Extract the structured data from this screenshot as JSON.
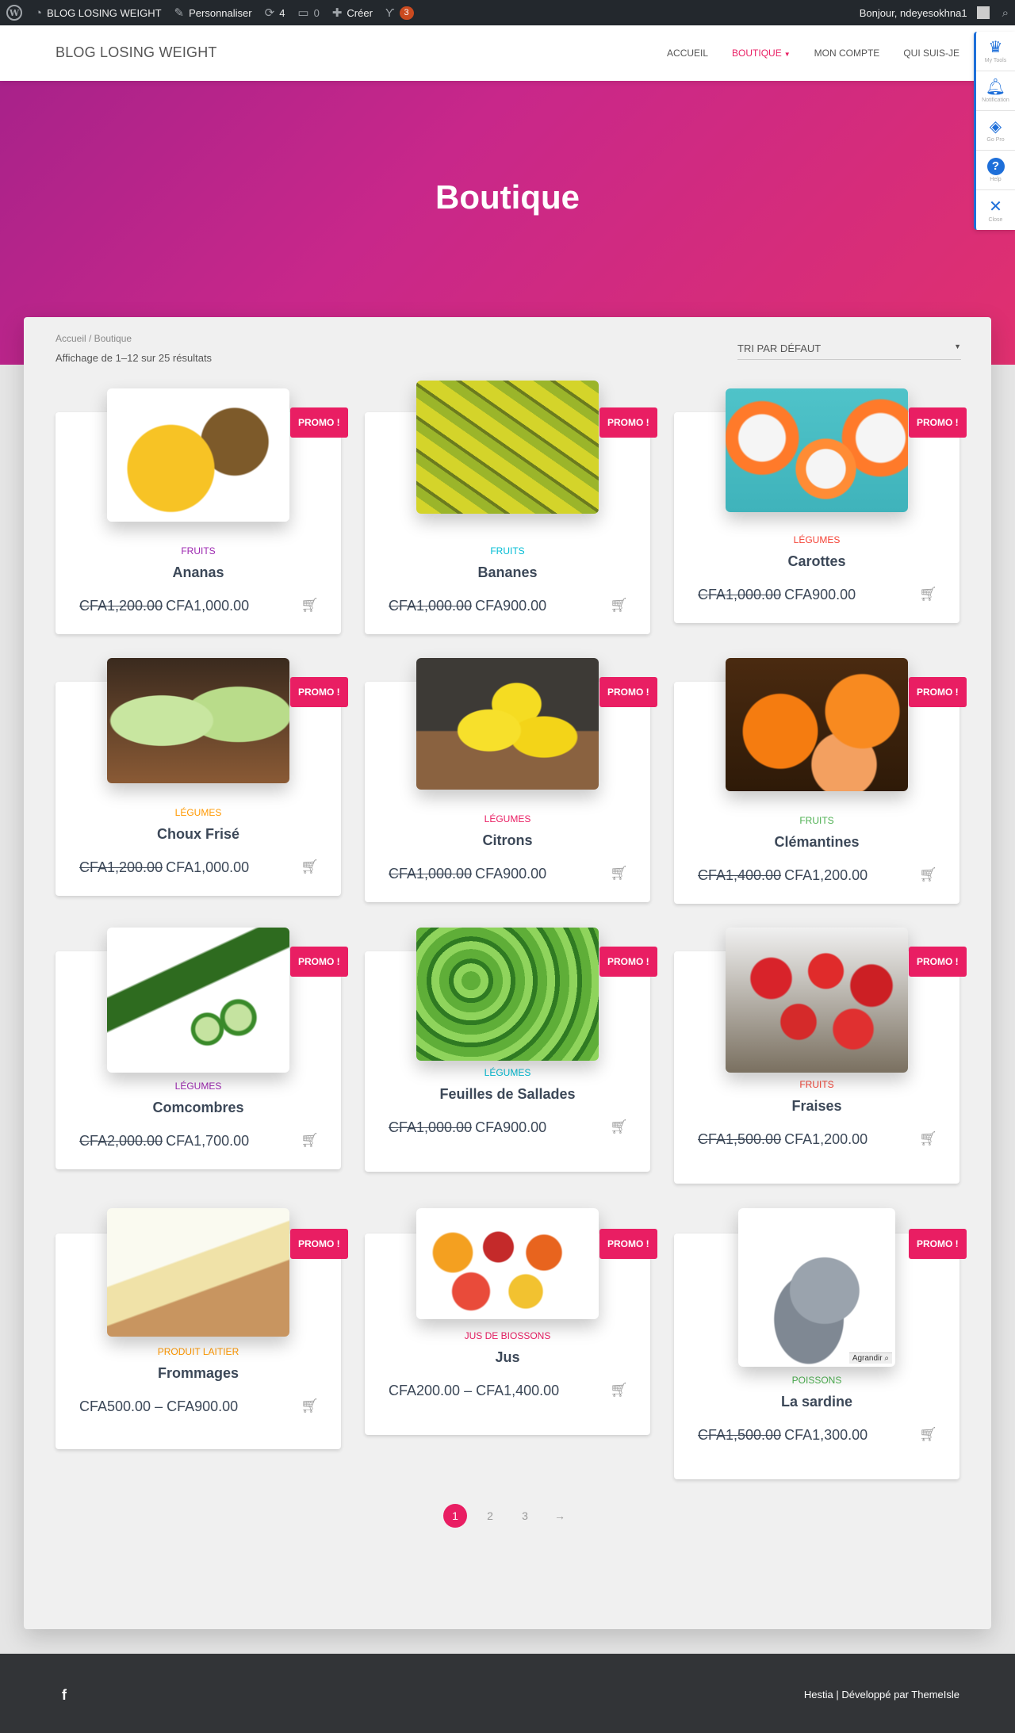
{
  "adminbar": {
    "site_name": "BLOG LOSING WEIGHT",
    "customize": "Personnaliser",
    "updates_count": "4",
    "comments_count": "0",
    "new": "Créer",
    "yoast_badge": "3",
    "greeting": "Bonjour, ndeyesokhna1"
  },
  "nav": {
    "brand": "BLOG LOSING WEIGHT",
    "items": [
      "ACCUEIL",
      "BOUTIQUE",
      "MON COMPTE",
      "QUI SUIS-JE"
    ],
    "active": "BOUTIQUE"
  },
  "hero": {
    "title": "Boutique"
  },
  "sidetools": [
    {
      "label": "My Tools",
      "icon": "crown-icon"
    },
    {
      "label": "Notification",
      "icon": "bell-icon"
    },
    {
      "label": "Go Pro",
      "icon": "diamond-icon"
    },
    {
      "label": "Help",
      "icon": "help-icon"
    },
    {
      "label": "Close",
      "icon": "close-icon"
    }
  ],
  "shop": {
    "breadcrumb": "Accueil / Boutique",
    "result_count": "Affichage de 1–12 sur 25 résultats",
    "sort_label": "TRI PAR DÉFAUT"
  },
  "products": [
    {
      "name": "Ananas",
      "category": "FRUITS",
      "cat_color": "#9c27b0",
      "old": "CFA1,200.00",
      "price": "CFA1,000.00",
      "promo": "PROMO !",
      "icon": "pineapple-image"
    },
    {
      "name": "Bananes",
      "category": "FRUITS",
      "cat_color": "#00bcd4",
      "old": "CFA1,000.00",
      "price": "CFA900.00",
      "promo": "PROMO !",
      "icon": "banana-image"
    },
    {
      "name": "Carottes",
      "category": "LÉGUMES",
      "cat_color": "#f44336",
      "old": "CFA1,000.00",
      "price": "CFA900.00",
      "promo": "PROMO !",
      "icon": "carrot-image"
    },
    {
      "name": "Choux Frisé",
      "category": "LÉGUMES",
      "cat_color": "#ff9800",
      "old": "CFA1,200.00",
      "price": "CFA1,000.00",
      "promo": "PROMO !",
      "icon": "cabbage-image"
    },
    {
      "name": "Citrons",
      "category": "LÉGUMES",
      "cat_color": "#e91e63",
      "old": "CFA1,000.00",
      "price": "CFA900.00",
      "promo": "PROMO !",
      "icon": "lemon-image"
    },
    {
      "name": "Clémantines",
      "category": "FRUITS",
      "cat_color": "#4caf50",
      "old": "CFA1,400.00",
      "price": "CFA1,200.00",
      "promo": "PROMO !",
      "icon": "clementine-image"
    },
    {
      "name": "Comcombres",
      "category": "LÉGUMES",
      "cat_color": "#9c27b0",
      "old": "CFA2,000.00",
      "price": "CFA1,700.00",
      "promo": "PROMO !",
      "icon": "cucumber-image"
    },
    {
      "name": "Feuilles de Sallades",
      "category": "LÉGUMES",
      "cat_color": "#00bcd4",
      "old": "CFA1,000.00",
      "price": "CFA900.00",
      "promo": "PROMO !",
      "icon": "lettuce-image"
    },
    {
      "name": "Fraises",
      "category": "FRUITS",
      "cat_color": "#f44336",
      "old": "CFA1,500.00",
      "price": "CFA1,200.00",
      "promo": "PROMO !",
      "icon": "strawberry-image"
    },
    {
      "name": "Frommages",
      "category": "PRODUIT LAITIER",
      "cat_color": "#ff9800",
      "old": "",
      "price": "CFA500.00 – CFA900.00",
      "promo": "PROMO !",
      "icon": "cheese-image"
    },
    {
      "name": "Jus",
      "category": "JUS DE BIOSSONS",
      "cat_color": "#e91e63",
      "old": "",
      "price": "CFA200.00 – CFA1,400.00",
      "promo": "PROMO !",
      "icon": "juice-image"
    },
    {
      "name": "La sardine",
      "category": "POISSONS",
      "cat_color": "#4caf50",
      "old": "CFA1,500.00",
      "price": "CFA1,300.00",
      "promo": "PROMO !",
      "icon": "sardine-image",
      "zoom_label": "Agrandir"
    }
  ],
  "pagination": {
    "pages": [
      "1",
      "2",
      "3"
    ],
    "current": "1",
    "next": "→"
  },
  "footer": {
    "social": "f",
    "brand": "Hestia",
    "sep": " | ",
    "dev": "Développé par ",
    "author": "ThemeIsle"
  }
}
